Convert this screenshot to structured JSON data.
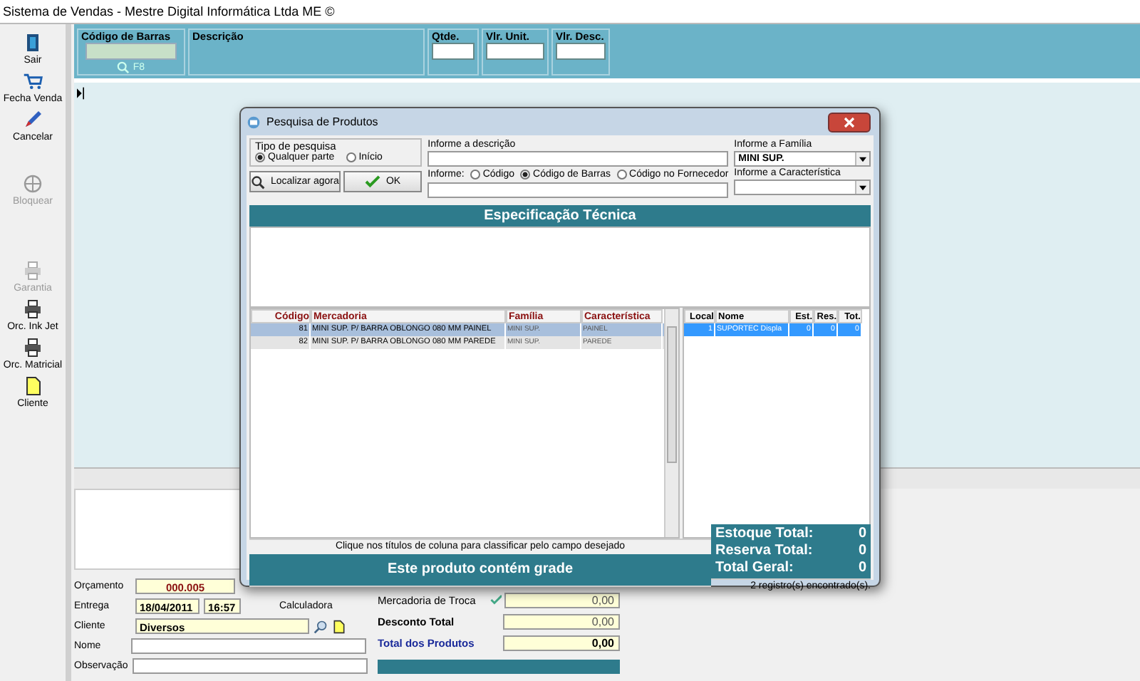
{
  "window": {
    "title": "Sistema de Vendas - Mestre Digital Informática Ltda ME ©"
  },
  "toolbar": [
    {
      "label": "Sair",
      "disabled": false
    },
    {
      "label": "Fecha Venda",
      "disabled": false
    },
    {
      "label": "Cancelar",
      "disabled": false
    },
    {
      "label": "Bloquear",
      "disabled": true
    },
    {
      "label": "Garantia",
      "disabled": true
    },
    {
      "label": "Orc. Ink Jet",
      "disabled": false
    },
    {
      "label": "Orc. Matricial",
      "disabled": false
    },
    {
      "label": "Cliente",
      "disabled": false
    }
  ],
  "header": {
    "barcode_label": "Código de Barras",
    "search_hint": "F8",
    "description_label": "Descrição",
    "fields": [
      "Qtde.",
      "Vlr. Unit.",
      "Vlr. Desc."
    ]
  },
  "form": {
    "orcamento_label": "Orçamento",
    "orcamento_value": "000.005",
    "entrega_label": "Entrega",
    "entrega_date": "18/04/2011",
    "entrega_time": "16:57",
    "calculadora": "Calculadora",
    "cliente_label": "Cliente",
    "cliente_value": "Diversos",
    "nome_label": "Nome",
    "observacao_label": "Observação"
  },
  "totals": [
    {
      "label": "Mercadoria de Troca",
      "value": "0,00",
      "kind": "check"
    },
    {
      "label": "Desconto Total",
      "value": "0,00",
      "kind": "bold"
    },
    {
      "label": "Total dos Produtos",
      "value": "0,00",
      "kind": "total"
    }
  ],
  "dialog": {
    "title": "Pesquisa de Produtos",
    "search_type": {
      "legend": "Tipo de pesquisa",
      "options": [
        {
          "label": "Qualquer parte",
          "selected": true
        },
        {
          "label": "Início",
          "selected": false
        }
      ]
    },
    "find_button": "Localizar agora",
    "ok_button": "OK",
    "description_label": "Informe a descrição",
    "informe_label": "Informe:",
    "informe_options": [
      {
        "label": "Código",
        "selected": false
      },
      {
        "label": "Código de Barras",
        "selected": true
      },
      {
        "label": "Código no Fornecedor",
        "selected": false
      }
    ],
    "family_label": "Informe a Família",
    "family_value": "MINI SUP.",
    "feature_label": "Informe a Característica",
    "spec_title": "Especificação Técnica",
    "products": {
      "columns": [
        "Código",
        "Mercadoria",
        "Família",
        "Característica"
      ],
      "rows": [
        {
          "cells": [
            "81",
            "MINI SUP. P/ BARRA OBLONGO 080 MM PAINEL",
            "MINI SUP.",
            "PAINEL"
          ],
          "selected": true
        },
        {
          "cells": [
            "82",
            "MINI SUP. P/ BARRA OBLONGO 080 MM PAREDE",
            "MINI SUP.",
            "PAREDE"
          ],
          "selected": false
        }
      ]
    },
    "stock": {
      "columns": [
        "Local",
        "Nome",
        "Est.",
        "Res.",
        "Tot."
      ],
      "rows": [
        {
          "cells": [
            "1",
            "SUPORTEC Displa",
            "0",
            "0",
            "0"
          ],
          "selected": true
        }
      ]
    },
    "hint": "Clique nos títulos de coluna para classificar pelo campo desejado",
    "grade_banner": "Este produto contém grade",
    "stock_totals": [
      {
        "label": "Estoque Total:",
        "value": "0"
      },
      {
        "label": "Reserva Total:",
        "value": "0"
      },
      {
        "label": "Total Geral:",
        "value": "0"
      }
    ],
    "status": "2 registro(s) encontrado(s)."
  }
}
